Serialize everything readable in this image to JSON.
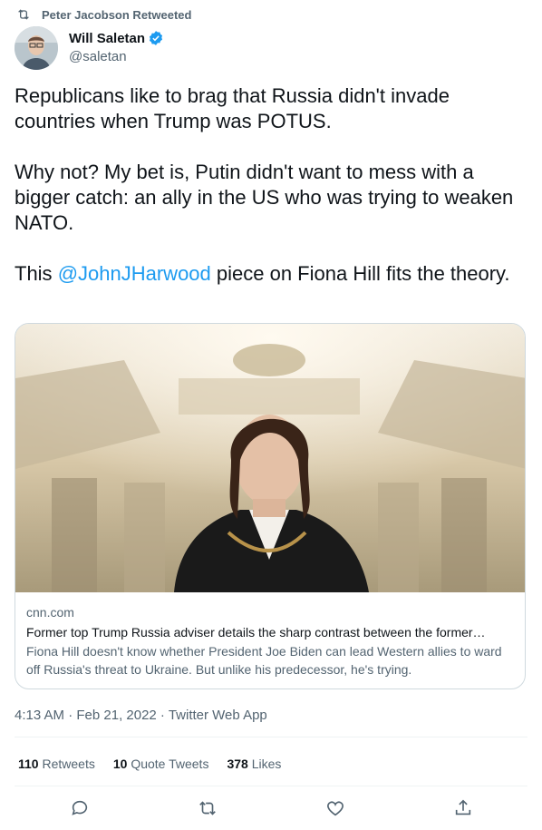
{
  "retweet_banner": {
    "text": "Peter Jacobson Retweeted",
    "icon": "retweet-icon"
  },
  "author": {
    "name": "Will Saletan",
    "handle": "@saletan",
    "verified_icon": "verified-badge-icon",
    "verified_color": "#1d9bf0"
  },
  "tweet": {
    "p1": "Republicans like to brag that Russia didn't invade countries when Trump was POTUS.",
    "p2": "Why not? My bet is, Putin didn't want to mess with a bigger catch: an ally in the US who was trying to weaken NATO.",
    "p3_before": "This ",
    "p3_mention": "@JohnJHarwood",
    "p3_after": " piece on Fiona Hill fits the theory."
  },
  "card": {
    "domain": "cnn.com",
    "title": "Former top Trump Russia adviser details the sharp contrast between the former…",
    "description": "Fiona Hill doesn't know whether President Joe Biden can lead Western allies to ward off Russia's threat to Ukraine. But unlike his predecessor, he's trying."
  },
  "meta": {
    "text": "4:13 AM · Feb 21, 2022 · Twitter Web App"
  },
  "stats": {
    "retweets_count": "110",
    "retweets_label": "Retweets",
    "quotes_count": "10",
    "quotes_label": "Quote Tweets",
    "likes_count": "378",
    "likes_label": "Likes"
  },
  "actions": [
    "reply-icon",
    "retweet-icon",
    "like-icon",
    "share-icon"
  ],
  "colors": {
    "text": "#0f1419",
    "secondary": "#536471",
    "link": "#1d9bf0",
    "border": "#cfd9de"
  }
}
